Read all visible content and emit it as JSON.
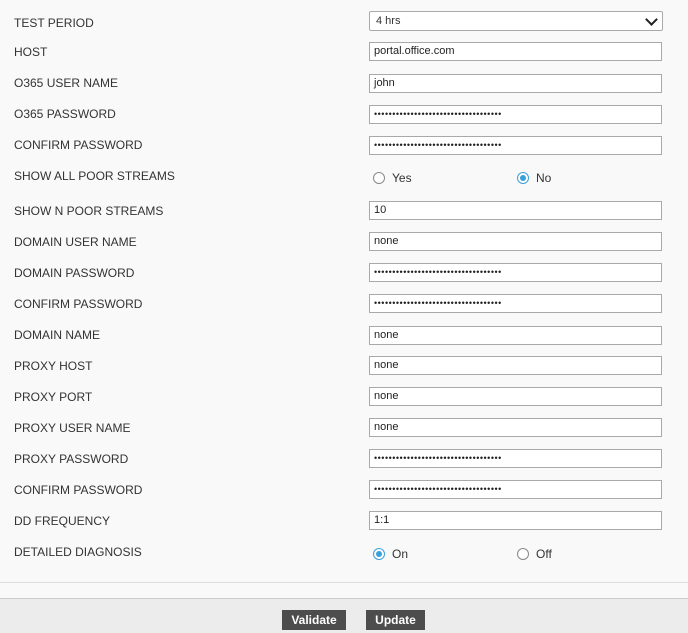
{
  "form": {
    "test_period": {
      "label": "TEST PERIOD",
      "value": "4 hrs"
    },
    "host": {
      "label": "HOST",
      "value": "portal.office.com"
    },
    "o365_user": {
      "label": "O365 USER NAME",
      "value": "john"
    },
    "o365_password": {
      "label": "O365 PASSWORD",
      "value": "•••••••••••••••••••••••••••••••••••"
    },
    "confirm_password_1": {
      "label": "CONFIRM PASSWORD",
      "value": "•••••••••••••••••••••••••••••••••••"
    },
    "show_all_poor_streams": {
      "label": "SHOW ALL POOR STREAMS",
      "option_yes": "Yes",
      "option_no": "No",
      "selected": "No"
    },
    "show_n_poor_streams": {
      "label": "SHOW N POOR STREAMS",
      "value": "10"
    },
    "domain_user": {
      "label": "DOMAIN USER NAME",
      "value": "none"
    },
    "domain_password": {
      "label": "DOMAIN PASSWORD",
      "value": "•••••••••••••••••••••••••••••••••••"
    },
    "confirm_password_2": {
      "label": "CONFIRM PASSWORD",
      "value": "•••••••••••••••••••••••••••••••••••"
    },
    "domain_name": {
      "label": "DOMAIN NAME",
      "value": "none"
    },
    "proxy_host": {
      "label": "PROXY HOST",
      "value": "none"
    },
    "proxy_port": {
      "label": "PROXY PORT",
      "value": "none"
    },
    "proxy_user": {
      "label": "PROXY USER NAME",
      "value": "none"
    },
    "proxy_password": {
      "label": "PROXY PASSWORD",
      "value": "•••••••••••••••••••••••••••••••••••"
    },
    "confirm_password_3": {
      "label": "CONFIRM PASSWORD",
      "value": "•••••••••••••••••••••••••••••••••••"
    },
    "dd_frequency": {
      "label": "DD FREQUENCY",
      "value": "1:1"
    },
    "detailed_diagnosis": {
      "label": "DETAILED DIAGNOSIS",
      "option_on": "On",
      "option_off": "Off",
      "selected": "On"
    }
  },
  "actions": {
    "validate_label": "Validate",
    "update_label": "Update"
  },
  "colors": {
    "accent": "#3aa0d8",
    "button_bg": "#4d4d4d"
  }
}
